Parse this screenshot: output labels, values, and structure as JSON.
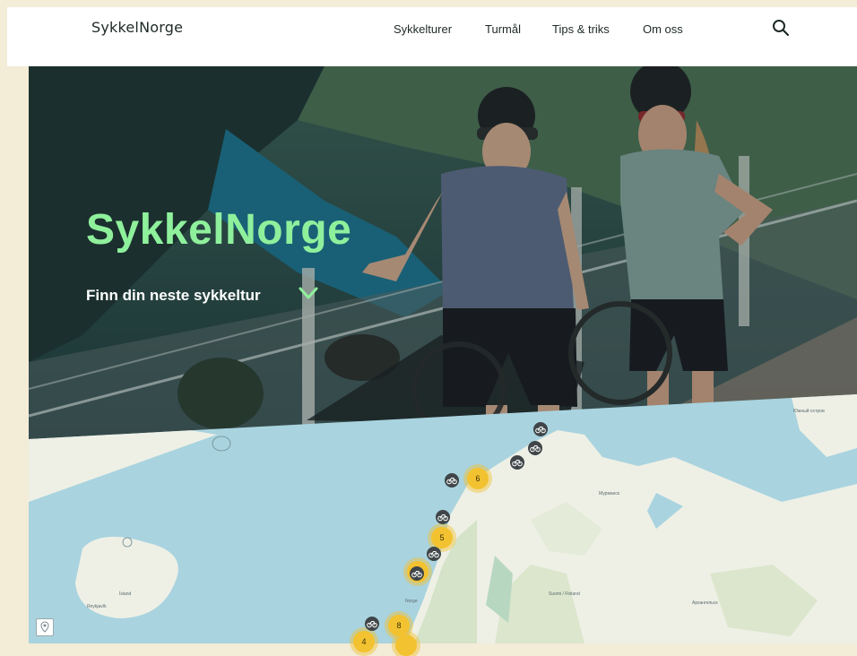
{
  "header": {
    "logo": "SykkelNorge",
    "nav": [
      "Sykkelturer",
      "Turmål",
      "Tips & triks",
      "Om oss"
    ]
  },
  "hero": {
    "title": "SykkelNorge",
    "subtitle": "Finn din neste sykkeltur"
  },
  "map": {
    "clusters": [
      "6",
      "5",
      "8",
      "4"
    ],
    "labels": [
      "Южный остров",
      "Мурманск",
      "Ísland",
      "Reykjavík",
      "Norge",
      "Suomi / Finland",
      "Архангельск"
    ]
  },
  "colors": {
    "accent": "#8ff09c",
    "cluster": "#f2c230",
    "sea": "#a9d3df",
    "land": "#eef0e6"
  }
}
